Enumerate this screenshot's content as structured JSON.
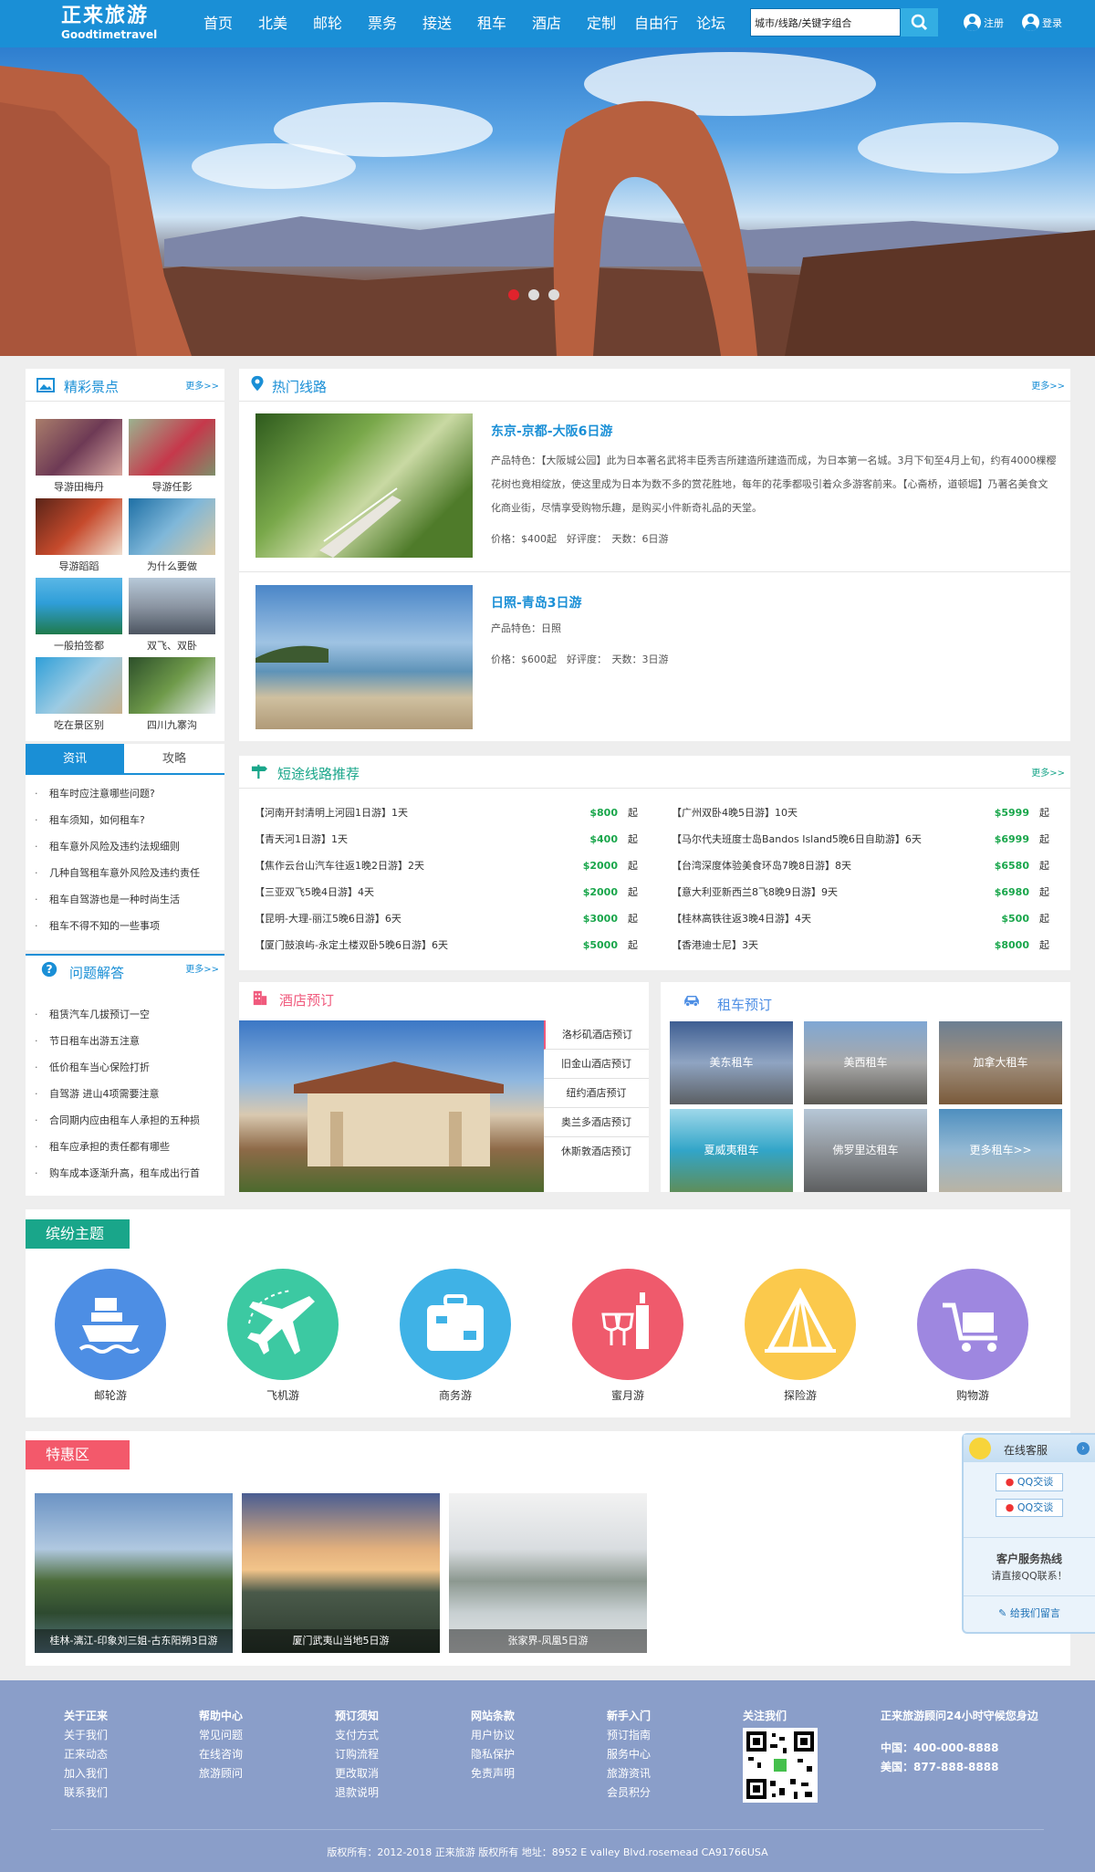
{
  "header": {
    "logo_cn": "正来旅游",
    "logo_en": "Goodtimetravel",
    "nav": [
      "首页",
      "北美",
      "邮轮",
      "票务",
      "接送",
      "租车",
      "酒店",
      "定制",
      "自由行",
      "论坛"
    ],
    "search_value": "城市/线路/关键字组合",
    "register": "注册",
    "login": "登录"
  },
  "banner": {
    "dots": 3,
    "active_dot": 0
  },
  "scenic": {
    "title": "精彩景点",
    "more": "更多>>",
    "items": [
      "导游田梅丹",
      "导游任影",
      "导游蹈蹈",
      "为什么要做",
      "一般拍签都",
      "双飞、双卧",
      "吃在景区别",
      "四川九寨沟"
    ]
  },
  "news_tabs": {
    "tabs": [
      "资讯",
      "攻略"
    ],
    "active": 0,
    "items": [
      "租车时应注意哪些问题?",
      "租车须知，如何租车?",
      "租车意外风险及违约法规细则",
      "几种自驾租车意外风险及违约责任",
      "租车自驾游也是一种时尚生活",
      "租车不得不知的一些事项"
    ]
  },
  "faq": {
    "title": "问题解答",
    "more": "更多>>",
    "items": [
      "租赁汽车几拔预订一空",
      "节日租车出游五注意",
      "低价租车当心保险打折",
      "自驾游 进山4项需要注意",
      "合同期内应由租车人承担的五种损",
      "租车应承担的责任都有哪些",
      "购车成本逐渐升高，租车成出行首"
    ]
  },
  "hot_routes": {
    "title": "热门线路",
    "more": "更多>>",
    "routes": [
      {
        "name": "东京-京都-大阪6日游",
        "feature_label": "产品特色：",
        "feature": "【大阪城公园】此为日本著名武将丰臣秀吉所建造所建造而成，为日本第一名城。3月下旬至4月上旬，约有4000棵樱花树也竟相绽放，使这里成为日本为数不多的赏花胜地，每年的花季都吸引着众多游客前来。【心斋桥，道顿堀】乃著名美食文化商业街，尽情享受购物乐趣，是购买小件新奇礼品的天堂。",
        "price_line": "价格：$400起　好评度：　天数：6日游"
      },
      {
        "name": "日照-青岛3日游",
        "feature_label": "产品特色：",
        "feature": "日照",
        "price_line": "价格：$600起　好评度：　天数：3日游"
      }
    ]
  },
  "short_routes": {
    "title": "短途线路推荐",
    "more": "更多>>",
    "left": [
      {
        "name": "【河南开封清明上河园1日游】1天",
        "price": "$800",
        "unit": "起"
      },
      {
        "name": "【青天河1日游】1天",
        "price": "$400",
        "unit": "起"
      },
      {
        "name": "【焦作云台山汽车往返1晚2日游】2天",
        "price": "$2000",
        "unit": "起"
      },
      {
        "name": "【三亚双飞5晚4日游】4天",
        "price": "$2000",
        "unit": "起"
      },
      {
        "name": "【昆明-大理-丽江5晚6日游】6天",
        "price": "$3000",
        "unit": "起"
      },
      {
        "name": "【厦门鼓浪屿-永定土楼双卧5晚6日游】6天",
        "price": "$5000",
        "unit": "起"
      }
    ],
    "right": [
      {
        "name": "【广州双卧4晚5日游】10天",
        "price": "$5999",
        "unit": "起"
      },
      {
        "name": "【马尔代夫班度士岛Bandos Island5晚6日自助游】6天",
        "price": "$6999",
        "unit": "起"
      },
      {
        "name": "【台湾深度体验美食环岛7晚8日游】8天",
        "price": "$6580",
        "unit": "起"
      },
      {
        "name": "【意大利亚新西兰8飞8晚9日游】9天",
        "price": "$6980",
        "unit": "起"
      },
      {
        "name": "【桂林高铁往返3晚4日游】4天",
        "price": "$500",
        "unit": "起"
      },
      {
        "name": "【香港迪士尼】3天",
        "price": "$8000",
        "unit": "起"
      }
    ]
  },
  "hotel": {
    "title": "酒店预订",
    "links": [
      "洛杉矶酒店预订",
      "旧金山酒店预订",
      "纽约酒店预订",
      "奥兰多酒店预订",
      "休斯敦酒店预订"
    ]
  },
  "car": {
    "title": "租车预订",
    "items": [
      "美东租车",
      "美西租车",
      "加拿大租车",
      "夏威夷租车",
      "佛罗里达租车",
      "更多租车>>"
    ]
  },
  "themes": {
    "title": "缤纷主题",
    "items": [
      {
        "label": "邮轮游",
        "color": "#4d8ee4",
        "icon": "ship-icon"
      },
      {
        "label": "飞机游",
        "color": "#3cc9a2",
        "icon": "plane-icon"
      },
      {
        "label": "商务游",
        "color": "#3fb2e6",
        "icon": "suitcase-icon"
      },
      {
        "label": "蜜月游",
        "color": "#ef5a6c",
        "icon": "wine-icon"
      },
      {
        "label": "探险游",
        "color": "#fbc94c",
        "icon": "tent-icon"
      },
      {
        "label": "购物游",
        "color": "#9e87e0",
        "icon": "cart-icon"
      }
    ]
  },
  "deals": {
    "title": "特惠区",
    "items": [
      "桂林-漓江-印象刘三姐-古东阳朔3日游",
      "厦门武夷山当地5日游",
      "张家界-凤凰5日游"
    ]
  },
  "online_service": {
    "title": "在线客服",
    "qq": [
      "QQ交谈",
      "QQ交谈"
    ],
    "hotline_title": "客户服务热线",
    "hotline_sub": "请直接QQ联系！",
    "message": "给我们留言"
  },
  "footer": {
    "columns": [
      {
        "title": "关于正来",
        "links": [
          "关于我们",
          "正来动态",
          "加入我们",
          "联系我们"
        ]
      },
      {
        "title": "帮助中心",
        "links": [
          "常见问题",
          "在线咨询",
          "旅游顾问"
        ]
      },
      {
        "title": "预订须知",
        "links": [
          "支付方式",
          "订购流程",
          "更改取消",
          "退款说明"
        ]
      },
      {
        "title": "网站条款",
        "links": [
          "用户协议",
          "隐私保护",
          "免责声明"
        ]
      },
      {
        "title": "新手入门",
        "links": [
          "预订指南",
          "服务中心",
          "旅游资讯",
          "会员积分"
        ]
      }
    ],
    "follow": "关注我们",
    "hotline_title": "正来旅游顾问24小时守候您身边",
    "china": "中国：400-000-8888",
    "usa": "美国：877-888-8888",
    "copyright": "版权所有：2012-2018 正来旅游 版权所有 地址：8952 E valley Blvd.rosemead CA91766USA"
  }
}
